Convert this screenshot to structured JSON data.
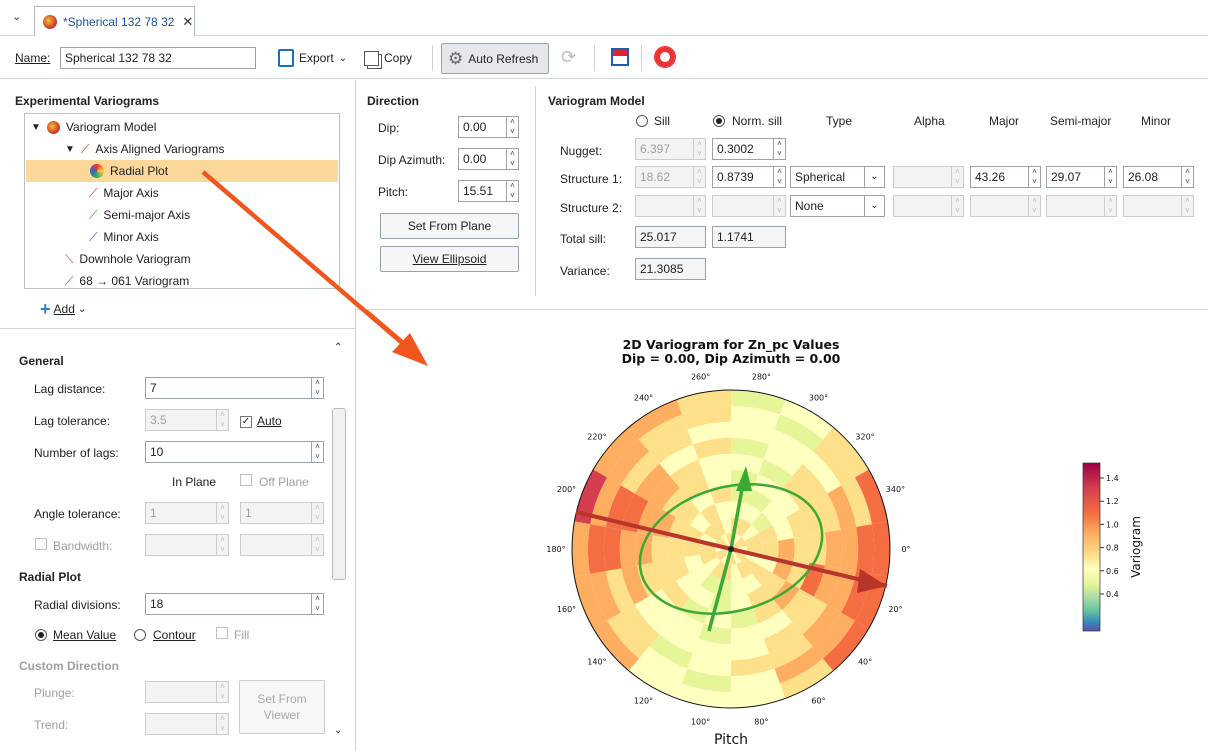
{
  "tab": {
    "title": "*Spherical 132 78 32"
  },
  "toolbar": {
    "name_label": "Name:",
    "name_value": "Spherical 132 78 32",
    "export_label": "Export",
    "copy_label": "Copy",
    "auto_refresh_label": "Auto Refresh"
  },
  "experimental": {
    "title": "Experimental Variograms",
    "items": [
      "Variogram Model",
      "Axis Aligned Variograms",
      "Radial Plot",
      "Major Axis",
      "Semi-major Axis",
      "Minor Axis",
      "Downhole Variogram",
      "68 → 061 Variogram"
    ],
    "add_label": "Add"
  },
  "general": {
    "title": "General",
    "lag_distance_label": "Lag distance:",
    "lag_distance": "7",
    "lag_tolerance_label": "Lag tolerance:",
    "lag_tolerance": "3.5",
    "auto_label": "Auto",
    "num_lags_label": "Number of lags:",
    "num_lags": "10",
    "in_plane_label": "In Plane",
    "off_plane_label": "Off Plane",
    "angle_tol_label": "Angle tolerance:",
    "angle_tol_in": "1",
    "angle_tol_off": "1",
    "bandwidth_label": "Bandwidth:"
  },
  "radial": {
    "title": "Radial Plot",
    "divisions_label": "Radial divisions:",
    "divisions": "18",
    "mean_label": "Mean Value",
    "contour_label": "Contour",
    "fill_label": "Fill"
  },
  "custom": {
    "title": "Custom Direction",
    "plunge_label": "Plunge:",
    "trend_label": "Trend:",
    "set_from_viewer": "Set From Viewer"
  },
  "direction": {
    "title": "Direction",
    "dip_label": "Dip:",
    "dip": "0.00",
    "azimuth_label": "Dip Azimuth:",
    "azimuth": "0.00",
    "pitch_label": "Pitch:",
    "pitch": "15.51",
    "set_from_plane": "Set From Plane",
    "view_ellipsoid": "View Ellipsoid"
  },
  "model": {
    "title": "Variogram Model",
    "sill_label": "Sill",
    "norm_sill_label": "Norm. sill",
    "headers": [
      "Type",
      "Alpha",
      "Major",
      "Semi-major",
      "Minor"
    ],
    "nugget_label": "Nugget:",
    "nugget_sill": "6.397",
    "nugget_norm": "0.3002",
    "s1_label": "Structure 1:",
    "s1_sill": "18.62",
    "s1_norm": "0.8739",
    "s1_type": "Spherical",
    "s1_major": "43.26",
    "s1_semi": "29.07",
    "s1_minor": "26.08",
    "s2_label": "Structure 2:",
    "s2_type": "None",
    "total_label": "Total sill:",
    "total_sill": "25.017",
    "total_norm": "1.1741",
    "variance_label": "Variance:",
    "variance": "21.3085"
  },
  "plot": {
    "title1": "2D Variogram for Zn_pc Values",
    "title2": "Dip = 0.00, Dip Azimuth = 0.00",
    "xlabel": "Pitch",
    "angle_labels": [
      "0°",
      "20°",
      "40°",
      "60°",
      "80°",
      "100°",
      "120°",
      "140°",
      "160°",
      "180°",
      "200°",
      "220°",
      "240°",
      "260°",
      "280°",
      "300°",
      "320°",
      "340°"
    ],
    "colorbar_label": "Variogram",
    "colorbar_ticks": [
      "1.4",
      "1.2",
      "1.0",
      "0.8",
      "0.6",
      "0.4"
    ]
  }
}
